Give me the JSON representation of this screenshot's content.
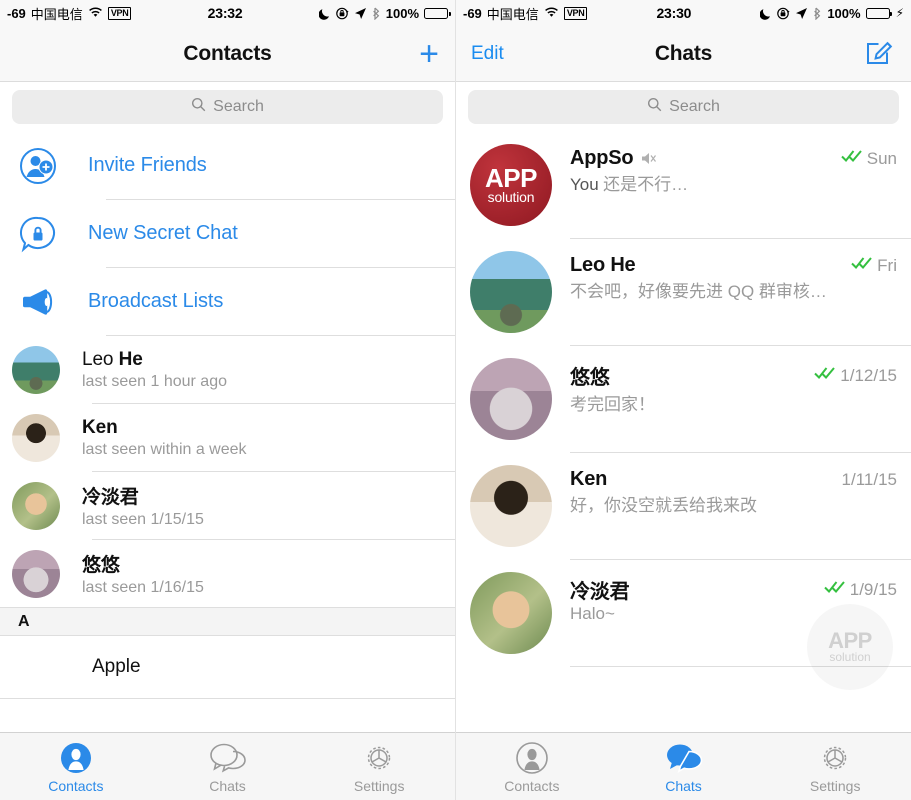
{
  "colors": {
    "accent": "#2b8ae8",
    "check_green": "#35c040",
    "muted_text": "#9a9a9a",
    "appso_red": "#9b1f28"
  },
  "left_phone": {
    "status_bar": {
      "signal": "-69",
      "carrier": "中国电信",
      "wifi_icon": "wifi-icon",
      "vpn": "VPN",
      "time": "23:32",
      "moon_icon": "moon-icon",
      "rotation_lock_icon": "rotation-lock-icon",
      "location_icon": "location-arrow-icon",
      "bluetooth_icon": "bluetooth-icon",
      "battery_percent": "100%",
      "battery_state": "full"
    },
    "nav": {
      "title": "Contacts",
      "right_action": "plus-icon"
    },
    "search": {
      "placeholder": "Search",
      "icon": "search-icon"
    },
    "actions": [
      {
        "label": "Invite Friends",
        "icon": "add-person-icon"
      },
      {
        "label": "New Secret Chat",
        "icon": "lock-chat-icon"
      },
      {
        "label": "Broadcast Lists",
        "icon": "megaphone-icon"
      }
    ],
    "contacts": [
      {
        "first": "Leo ",
        "last": "He",
        "subtitle": "last seen 1 hour ago",
        "avatar": "ph-leo"
      },
      {
        "first": "",
        "last": "Ken",
        "subtitle": "last seen within a week",
        "avatar": "ph-ken"
      },
      {
        "first": "",
        "last": "冷淡君",
        "subtitle": "last seen 1/15/15",
        "avatar": "ph-leng"
      },
      {
        "first": "",
        "last": "悠悠",
        "subtitle": "last seen 1/16/15",
        "avatar": "ph-cat"
      }
    ],
    "section_header": "A",
    "section_items": [
      {
        "label": "Apple"
      }
    ],
    "tabs": [
      {
        "label": "Contacts",
        "icon": "person-icon",
        "active": true
      },
      {
        "label": "Chats",
        "icon": "chat-bubbles-icon",
        "active": false
      },
      {
        "label": "Settings",
        "icon": "gear-icon",
        "active": false
      }
    ]
  },
  "right_phone": {
    "status_bar": {
      "signal": "-69",
      "carrier": "中国电信",
      "wifi_icon": "wifi-icon",
      "vpn": "VPN",
      "time": "23:30",
      "moon_icon": "moon-icon",
      "rotation_lock_icon": "rotation-lock-icon",
      "location_icon": "location-arrow-icon",
      "bluetooth_icon": "bluetooth-icon",
      "battery_percent": "100%",
      "battery_state": "charging"
    },
    "nav": {
      "left_action": "Edit",
      "title": "Chats",
      "right_action": "compose-icon"
    },
    "search": {
      "placeholder": "Search",
      "icon": "search-icon"
    },
    "chats": [
      {
        "name": "AppSo",
        "muted": true,
        "sender": "You",
        "preview": "还是不行…",
        "date": "Sun",
        "read_status": "double-check",
        "avatar": "ph-appso"
      },
      {
        "name": "Leo He",
        "muted": false,
        "sender": "",
        "preview": "不会吧，好像要先进 QQ 群审核…",
        "date": "Fri",
        "read_status": "double-check",
        "avatar": "ph-leo"
      },
      {
        "name": "悠悠",
        "muted": false,
        "sender": "",
        "preview": "考完回家！",
        "date": "1/12/15",
        "read_status": "double-check",
        "avatar": "ph-cat"
      },
      {
        "name": "Ken",
        "muted": false,
        "sender": "",
        "preview": "好，你没空就丢给我来改",
        "date": "1/11/15",
        "read_status": "none",
        "avatar": "ph-ken"
      },
      {
        "name": "冷淡君",
        "muted": false,
        "sender": "",
        "preview": "Halo~",
        "date": "1/9/15",
        "read_status": "double-check",
        "avatar": "ph-leng"
      }
    ],
    "watermark": {
      "line1": "APP",
      "line2": "solution"
    },
    "tabs": [
      {
        "label": "Contacts",
        "icon": "person-icon",
        "active": false
      },
      {
        "label": "Chats",
        "icon": "chat-bubbles-icon",
        "active": true
      },
      {
        "label": "Settings",
        "icon": "gear-icon",
        "active": false
      }
    ]
  }
}
